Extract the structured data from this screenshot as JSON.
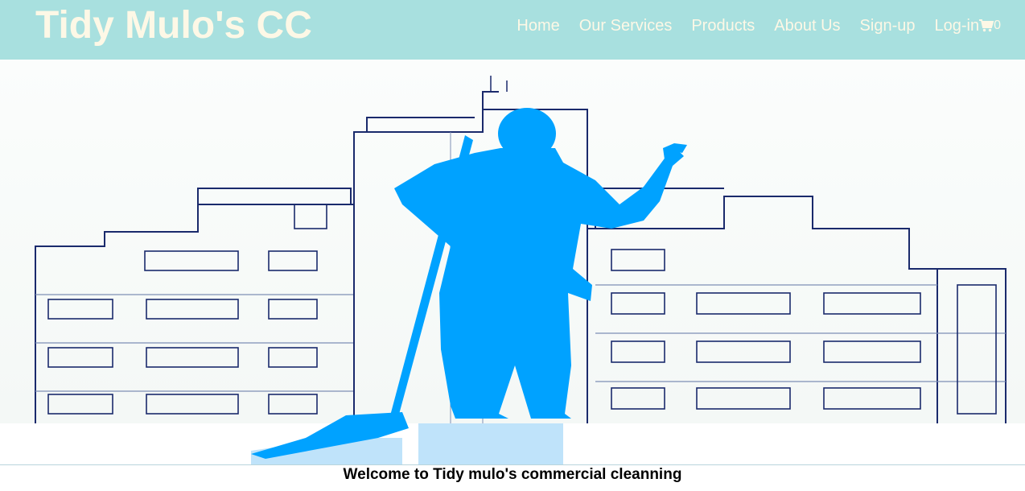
{
  "header": {
    "brand": "Tidy Mulo's CC",
    "nav": [
      {
        "label": "Home"
      },
      {
        "label": "Our Services"
      },
      {
        "label": "Products"
      },
      {
        "label": "About Us"
      },
      {
        "label": "Sign-up"
      },
      {
        "label": "Log-in"
      }
    ],
    "cart": {
      "icon": "shopping-cart-icon",
      "count": "0"
    }
  },
  "hero": {
    "image": "cleaner-silhouette-with-mop-in-front-of-buildings"
  },
  "welcome": {
    "text": "Welcome to Tidy mulo's commercial cleanning"
  },
  "colors": {
    "header_bg": "#a8e0df",
    "header_text": "#fdf8e6",
    "silhouette": "#00a2ff",
    "building_outline": "#1a2a6c"
  }
}
